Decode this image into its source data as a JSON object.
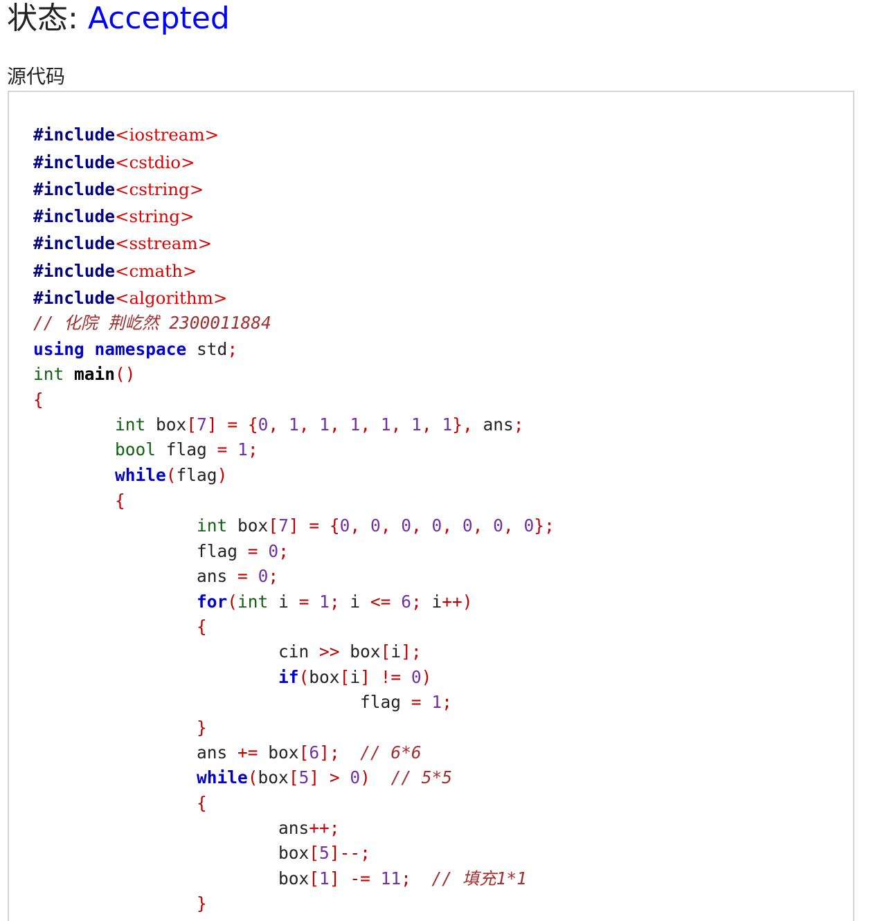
{
  "status": {
    "label": "状态: ",
    "value": "Accepted"
  },
  "source_heading": "源代码",
  "colors": {
    "status_value": "#0000ff",
    "preprocessor": "#000080",
    "header_string": "#e00000",
    "keyword": "#0000cc",
    "type": "#106010",
    "number": "#7030a0",
    "operator": "#c00000",
    "comment": "#a03030"
  },
  "code_lines": [
    [
      {
        "t": "pp",
        "s": "#include"
      },
      {
        "t": "str",
        "s": "<iostream>"
      }
    ],
    [
      {
        "t": "pp",
        "s": "#include"
      },
      {
        "t": "str",
        "s": "<cstdio>"
      }
    ],
    [
      {
        "t": "pp",
        "s": "#include"
      },
      {
        "t": "str",
        "s": "<cstring>"
      }
    ],
    [
      {
        "t": "pp",
        "s": "#include"
      },
      {
        "t": "str",
        "s": "<string>"
      }
    ],
    [
      {
        "t": "pp",
        "s": "#include"
      },
      {
        "t": "str",
        "s": "<sstream>"
      }
    ],
    [
      {
        "t": "pp",
        "s": "#include"
      },
      {
        "t": "str",
        "s": "<cmath>"
      }
    ],
    [
      {
        "t": "pp",
        "s": "#include"
      },
      {
        "t": "str",
        "s": "<algorithm>"
      }
    ],
    [
      {
        "t": "cm",
        "s": "// 化院 荆屹然 2300011884"
      }
    ],
    [
      {
        "t": "kw",
        "s": "using"
      },
      {
        "t": "ws",
        "s": " "
      },
      {
        "t": "kw",
        "s": "namespace"
      },
      {
        "t": "id",
        "s": " std"
      },
      {
        "t": "op",
        "s": ";"
      }
    ],
    [
      {
        "t": "type",
        "s": "int"
      },
      {
        "t": "ws",
        "s": " "
      },
      {
        "t": "fn",
        "s": "main"
      },
      {
        "t": "op",
        "s": "()"
      }
    ],
    [
      {
        "t": "op",
        "s": "{"
      }
    ],
    [
      {
        "t": "ws",
        "s": "        "
      },
      {
        "t": "type",
        "s": "int"
      },
      {
        "t": "id",
        "s": " box"
      },
      {
        "t": "op",
        "s": "["
      },
      {
        "t": "num",
        "s": "7"
      },
      {
        "t": "op",
        "s": "]"
      },
      {
        "t": "ws",
        "s": " "
      },
      {
        "t": "op",
        "s": "="
      },
      {
        "t": "ws",
        "s": " "
      },
      {
        "t": "op",
        "s": "{"
      },
      {
        "t": "num",
        "s": "0"
      },
      {
        "t": "op",
        "s": ","
      },
      {
        "t": "ws",
        "s": " "
      },
      {
        "t": "num",
        "s": "1"
      },
      {
        "t": "op",
        "s": ","
      },
      {
        "t": "ws",
        "s": " "
      },
      {
        "t": "num",
        "s": "1"
      },
      {
        "t": "op",
        "s": ","
      },
      {
        "t": "ws",
        "s": " "
      },
      {
        "t": "num",
        "s": "1"
      },
      {
        "t": "op",
        "s": ","
      },
      {
        "t": "ws",
        "s": " "
      },
      {
        "t": "num",
        "s": "1"
      },
      {
        "t": "op",
        "s": ","
      },
      {
        "t": "ws",
        "s": " "
      },
      {
        "t": "num",
        "s": "1"
      },
      {
        "t": "op",
        "s": ","
      },
      {
        "t": "ws",
        "s": " "
      },
      {
        "t": "num",
        "s": "1"
      },
      {
        "t": "op",
        "s": "}"
      },
      {
        "t": "op",
        "s": ","
      },
      {
        "t": "id",
        "s": " ans"
      },
      {
        "t": "op",
        "s": ";"
      }
    ],
    [
      {
        "t": "ws",
        "s": "        "
      },
      {
        "t": "type",
        "s": "bool"
      },
      {
        "t": "id",
        "s": " flag "
      },
      {
        "t": "op",
        "s": "="
      },
      {
        "t": "ws",
        "s": " "
      },
      {
        "t": "num",
        "s": "1"
      },
      {
        "t": "op",
        "s": ";"
      }
    ],
    [
      {
        "t": "ws",
        "s": "        "
      },
      {
        "t": "kw",
        "s": "while"
      },
      {
        "t": "op",
        "s": "("
      },
      {
        "t": "id",
        "s": "flag"
      },
      {
        "t": "op",
        "s": ")"
      }
    ],
    [
      {
        "t": "ws",
        "s": "        "
      },
      {
        "t": "op",
        "s": "{"
      }
    ],
    [
      {
        "t": "ws",
        "s": "                "
      },
      {
        "t": "type",
        "s": "int"
      },
      {
        "t": "id",
        "s": " box"
      },
      {
        "t": "op",
        "s": "["
      },
      {
        "t": "num",
        "s": "7"
      },
      {
        "t": "op",
        "s": "]"
      },
      {
        "t": "ws",
        "s": " "
      },
      {
        "t": "op",
        "s": "="
      },
      {
        "t": "ws",
        "s": " "
      },
      {
        "t": "op",
        "s": "{"
      },
      {
        "t": "num",
        "s": "0"
      },
      {
        "t": "op",
        "s": ","
      },
      {
        "t": "ws",
        "s": " "
      },
      {
        "t": "num",
        "s": "0"
      },
      {
        "t": "op",
        "s": ","
      },
      {
        "t": "ws",
        "s": " "
      },
      {
        "t": "num",
        "s": "0"
      },
      {
        "t": "op",
        "s": ","
      },
      {
        "t": "ws",
        "s": " "
      },
      {
        "t": "num",
        "s": "0"
      },
      {
        "t": "op",
        "s": ","
      },
      {
        "t": "ws",
        "s": " "
      },
      {
        "t": "num",
        "s": "0"
      },
      {
        "t": "op",
        "s": ","
      },
      {
        "t": "ws",
        "s": " "
      },
      {
        "t": "num",
        "s": "0"
      },
      {
        "t": "op",
        "s": ","
      },
      {
        "t": "ws",
        "s": " "
      },
      {
        "t": "num",
        "s": "0"
      },
      {
        "t": "op",
        "s": "}"
      },
      {
        "t": "op",
        "s": ";"
      }
    ],
    [
      {
        "t": "ws",
        "s": "                "
      },
      {
        "t": "id",
        "s": "flag "
      },
      {
        "t": "op",
        "s": "="
      },
      {
        "t": "ws",
        "s": " "
      },
      {
        "t": "num",
        "s": "0"
      },
      {
        "t": "op",
        "s": ";"
      }
    ],
    [
      {
        "t": "ws",
        "s": "                "
      },
      {
        "t": "id",
        "s": "ans "
      },
      {
        "t": "op",
        "s": "="
      },
      {
        "t": "ws",
        "s": " "
      },
      {
        "t": "num",
        "s": "0"
      },
      {
        "t": "op",
        "s": ";"
      }
    ],
    [
      {
        "t": "ws",
        "s": "                "
      },
      {
        "t": "kw",
        "s": "for"
      },
      {
        "t": "op",
        "s": "("
      },
      {
        "t": "type",
        "s": "int"
      },
      {
        "t": "id",
        "s": " i "
      },
      {
        "t": "op",
        "s": "="
      },
      {
        "t": "ws",
        "s": " "
      },
      {
        "t": "num",
        "s": "1"
      },
      {
        "t": "op",
        "s": ";"
      },
      {
        "t": "id",
        "s": " i "
      },
      {
        "t": "op",
        "s": "<="
      },
      {
        "t": "ws",
        "s": " "
      },
      {
        "t": "num",
        "s": "6"
      },
      {
        "t": "op",
        "s": ";"
      },
      {
        "t": "id",
        "s": " i"
      },
      {
        "t": "op",
        "s": "++)"
      }
    ],
    [
      {
        "t": "ws",
        "s": "                "
      },
      {
        "t": "op",
        "s": "{"
      }
    ],
    [
      {
        "t": "ws",
        "s": "                        "
      },
      {
        "t": "id",
        "s": "cin "
      },
      {
        "t": "op",
        "s": ">>"
      },
      {
        "t": "id",
        "s": " box"
      },
      {
        "t": "op",
        "s": "["
      },
      {
        "t": "id",
        "s": "i"
      },
      {
        "t": "op",
        "s": "];"
      }
    ],
    [
      {
        "t": "ws",
        "s": "                        "
      },
      {
        "t": "kw",
        "s": "if"
      },
      {
        "t": "op",
        "s": "("
      },
      {
        "t": "id",
        "s": "box"
      },
      {
        "t": "op",
        "s": "["
      },
      {
        "t": "id",
        "s": "i"
      },
      {
        "t": "op",
        "s": "]"
      },
      {
        "t": "ws",
        "s": " "
      },
      {
        "t": "op",
        "s": "!="
      },
      {
        "t": "ws",
        "s": " "
      },
      {
        "t": "num",
        "s": "0"
      },
      {
        "t": "op",
        "s": ")"
      }
    ],
    [
      {
        "t": "ws",
        "s": "                                "
      },
      {
        "t": "id",
        "s": "flag "
      },
      {
        "t": "op",
        "s": "="
      },
      {
        "t": "ws",
        "s": " "
      },
      {
        "t": "num",
        "s": "1"
      },
      {
        "t": "op",
        "s": ";"
      }
    ],
    [
      {
        "t": "ws",
        "s": "                "
      },
      {
        "t": "op",
        "s": "}"
      }
    ],
    [
      {
        "t": "ws",
        "s": "                "
      },
      {
        "t": "id",
        "s": "ans "
      },
      {
        "t": "op",
        "s": "+="
      },
      {
        "t": "id",
        "s": " box"
      },
      {
        "t": "op",
        "s": "["
      },
      {
        "t": "num",
        "s": "6"
      },
      {
        "t": "op",
        "s": "];"
      },
      {
        "t": "ws",
        "s": "  "
      },
      {
        "t": "cm",
        "s": "// 6*6"
      }
    ],
    [
      {
        "t": "ws",
        "s": "                "
      },
      {
        "t": "kw",
        "s": "while"
      },
      {
        "t": "op",
        "s": "("
      },
      {
        "t": "id",
        "s": "box"
      },
      {
        "t": "op",
        "s": "["
      },
      {
        "t": "num",
        "s": "5"
      },
      {
        "t": "op",
        "s": "]"
      },
      {
        "t": "ws",
        "s": " "
      },
      {
        "t": "op",
        "s": ">"
      },
      {
        "t": "ws",
        "s": " "
      },
      {
        "t": "num",
        "s": "0"
      },
      {
        "t": "op",
        "s": ")"
      },
      {
        "t": "ws",
        "s": "  "
      },
      {
        "t": "cm",
        "s": "// 5*5"
      }
    ],
    [
      {
        "t": "ws",
        "s": "                "
      },
      {
        "t": "op",
        "s": "{"
      }
    ],
    [
      {
        "t": "ws",
        "s": "                        "
      },
      {
        "t": "id",
        "s": "ans"
      },
      {
        "t": "op",
        "s": "++;"
      }
    ],
    [
      {
        "t": "ws",
        "s": "                        "
      },
      {
        "t": "id",
        "s": "box"
      },
      {
        "t": "op",
        "s": "["
      },
      {
        "t": "num",
        "s": "5"
      },
      {
        "t": "op",
        "s": "]--;"
      }
    ],
    [
      {
        "t": "ws",
        "s": "                        "
      },
      {
        "t": "id",
        "s": "box"
      },
      {
        "t": "op",
        "s": "["
      },
      {
        "t": "num",
        "s": "1"
      },
      {
        "t": "op",
        "s": "]"
      },
      {
        "t": "ws",
        "s": " "
      },
      {
        "t": "op",
        "s": "-="
      },
      {
        "t": "ws",
        "s": " "
      },
      {
        "t": "num",
        "s": "11"
      },
      {
        "t": "op",
        "s": ";"
      },
      {
        "t": "ws",
        "s": "  "
      },
      {
        "t": "cm",
        "s": "// 填充1*1"
      }
    ],
    [
      {
        "t": "ws",
        "s": "                "
      },
      {
        "t": "op",
        "s": "}"
      }
    ]
  ]
}
